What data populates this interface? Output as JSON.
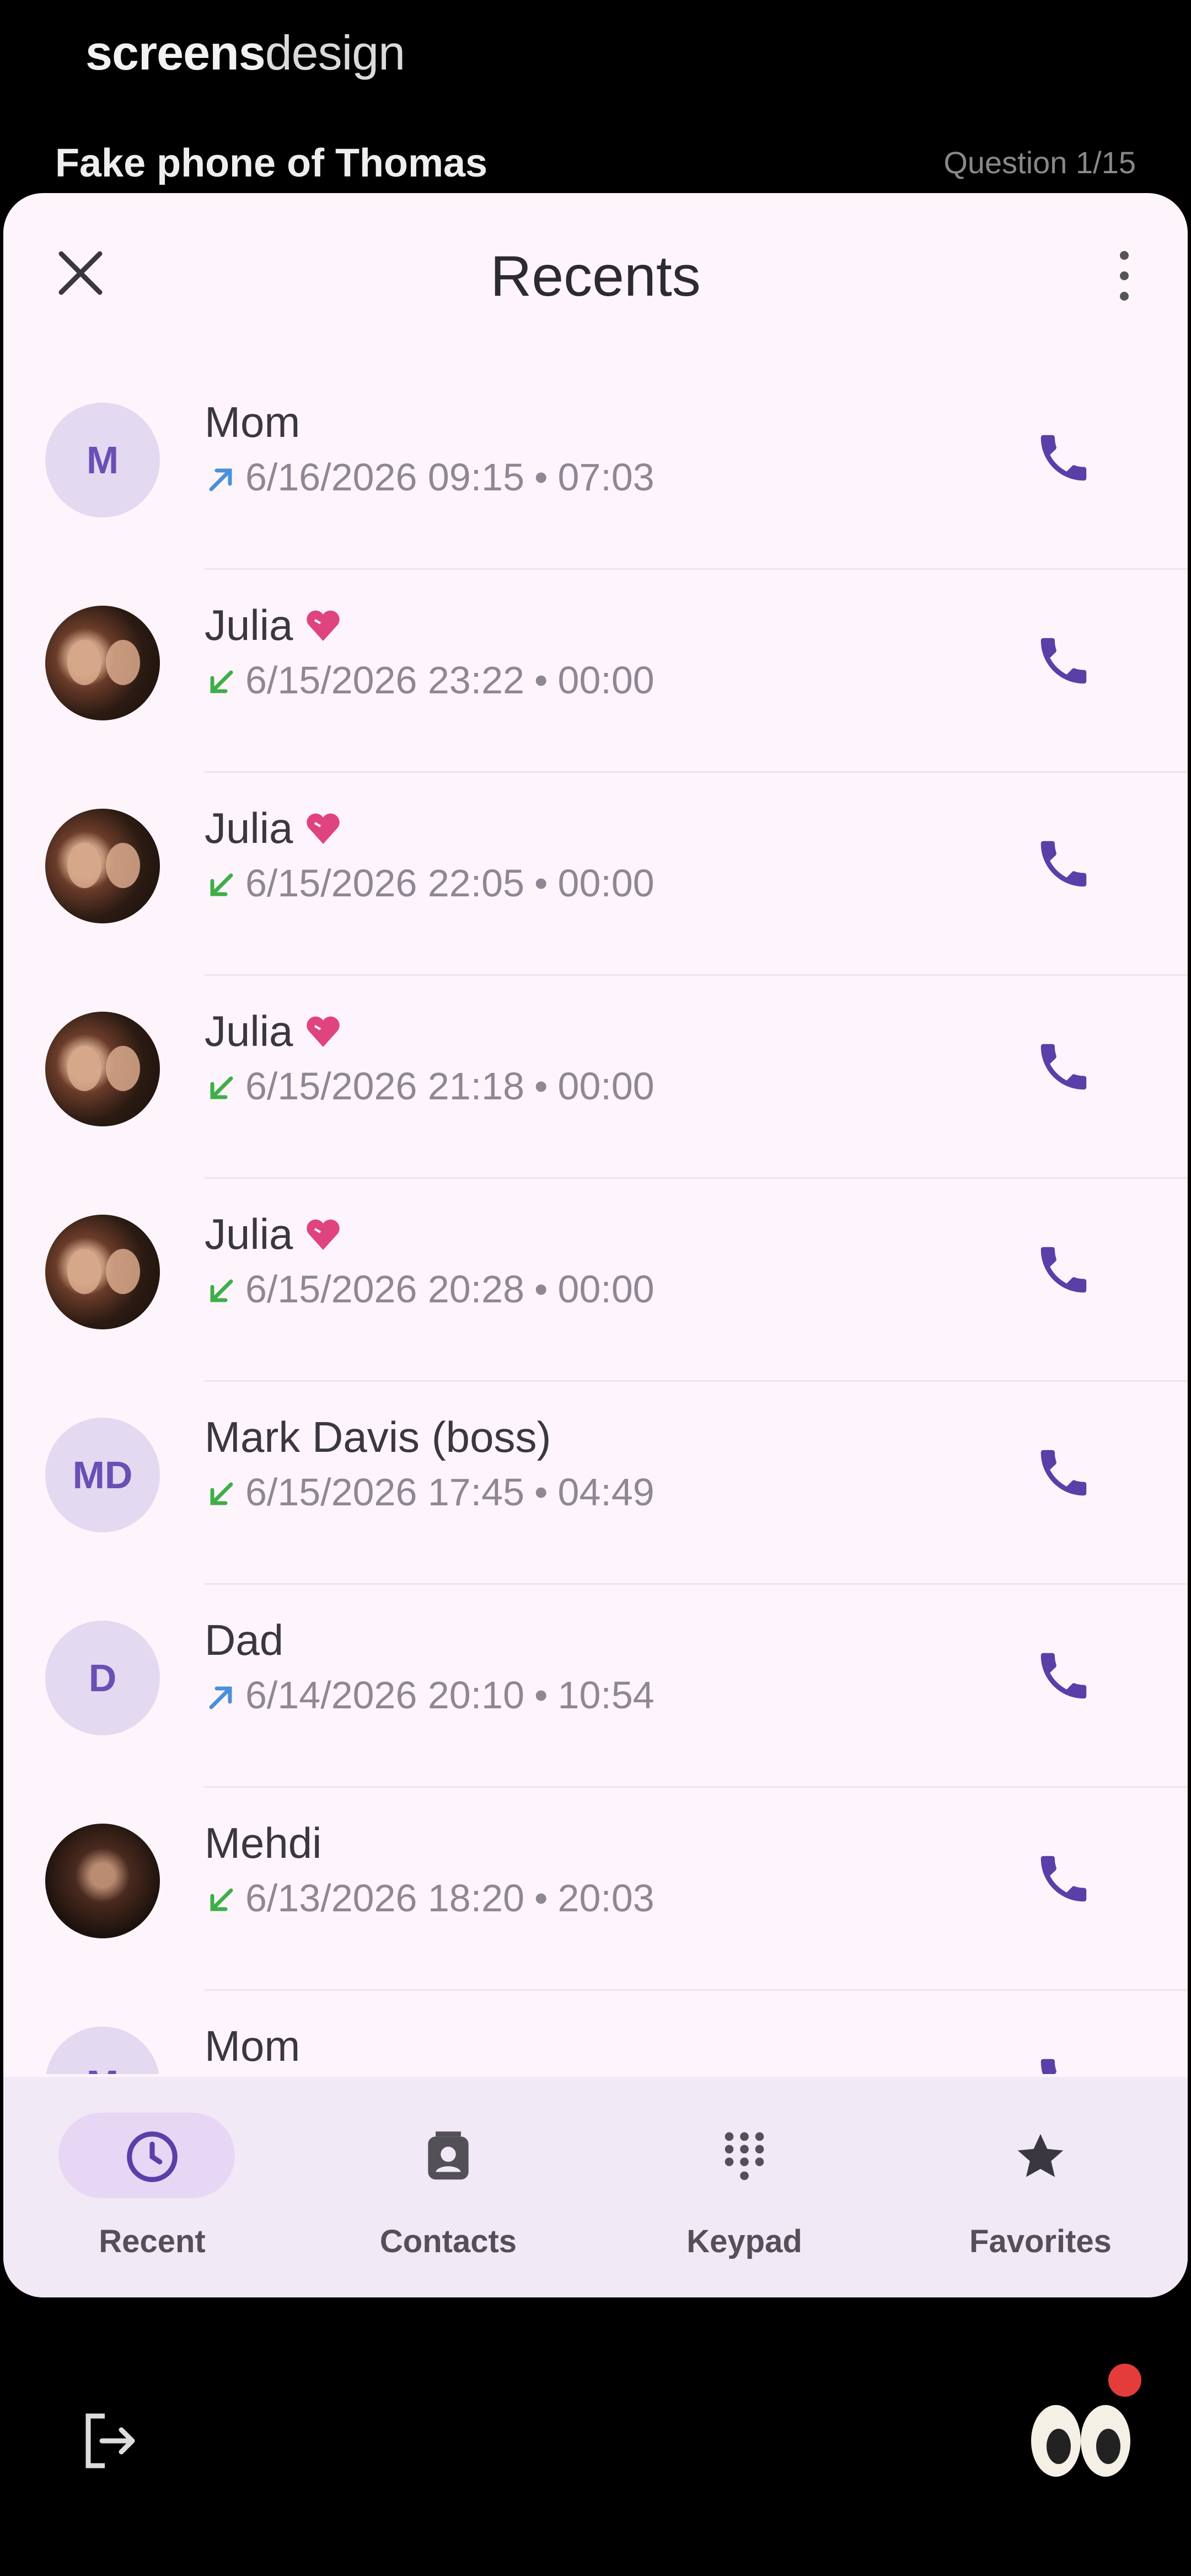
{
  "brand": {
    "bold": "screens",
    "light": "design"
  },
  "phone_name": "Fake phone of Thomas",
  "question": "Question 1/15",
  "header": {
    "title": "Recents"
  },
  "calls": [
    {
      "name": "Mom",
      "initials": "M",
      "avatar": "initials",
      "direction": "outgoing",
      "datetime": "6/16/2026 09:15",
      "duration": "07:03",
      "heart": false
    },
    {
      "name": "Julia",
      "initials": "",
      "avatar": "photo",
      "direction": "incoming",
      "datetime": "6/15/2026 23:22",
      "duration": "00:00",
      "heart": true
    },
    {
      "name": "Julia",
      "initials": "",
      "avatar": "photo",
      "direction": "incoming",
      "datetime": "6/15/2026 22:05",
      "duration": "00:00",
      "heart": true
    },
    {
      "name": "Julia",
      "initials": "",
      "avatar": "photo",
      "direction": "incoming",
      "datetime": "6/15/2026 21:18",
      "duration": "00:00",
      "heart": true
    },
    {
      "name": "Julia",
      "initials": "",
      "avatar": "photo",
      "direction": "incoming",
      "datetime": "6/15/2026 20:28",
      "duration": "00:00",
      "heart": true
    },
    {
      "name": "Mark Davis (boss)",
      "initials": "MD",
      "avatar": "initials",
      "direction": "incoming",
      "datetime": "6/15/2026 17:45",
      "duration": "04:49",
      "heart": false
    },
    {
      "name": "Dad",
      "initials": "D",
      "avatar": "initials",
      "direction": "outgoing",
      "datetime": "6/14/2026 20:10",
      "duration": "10:54",
      "heart": false
    },
    {
      "name": "Mehdi",
      "initials": "",
      "avatar": "photo2",
      "direction": "incoming",
      "datetime": "6/13/2026 18:20",
      "duration": "20:03",
      "heart": false
    },
    {
      "name": "Mom",
      "initials": "M",
      "avatar": "initials",
      "direction": "outgoing",
      "datetime": "",
      "duration": "",
      "heart": false
    }
  ],
  "nav": [
    {
      "label": "Recent",
      "icon": "clock-icon",
      "active": true
    },
    {
      "label": "Contacts",
      "icon": "contacts-icon",
      "active": false
    },
    {
      "label": "Keypad",
      "icon": "keypad-icon",
      "active": false
    },
    {
      "label": "Favorites",
      "icon": "star-icon",
      "active": false
    }
  ],
  "colors": {
    "accent": "#5b3fa8",
    "sheet_bg": "#fdf5fb",
    "nav_bg": "#f1e9f5",
    "outgoing": "#4a90d9",
    "incoming": "#3fae49"
  }
}
